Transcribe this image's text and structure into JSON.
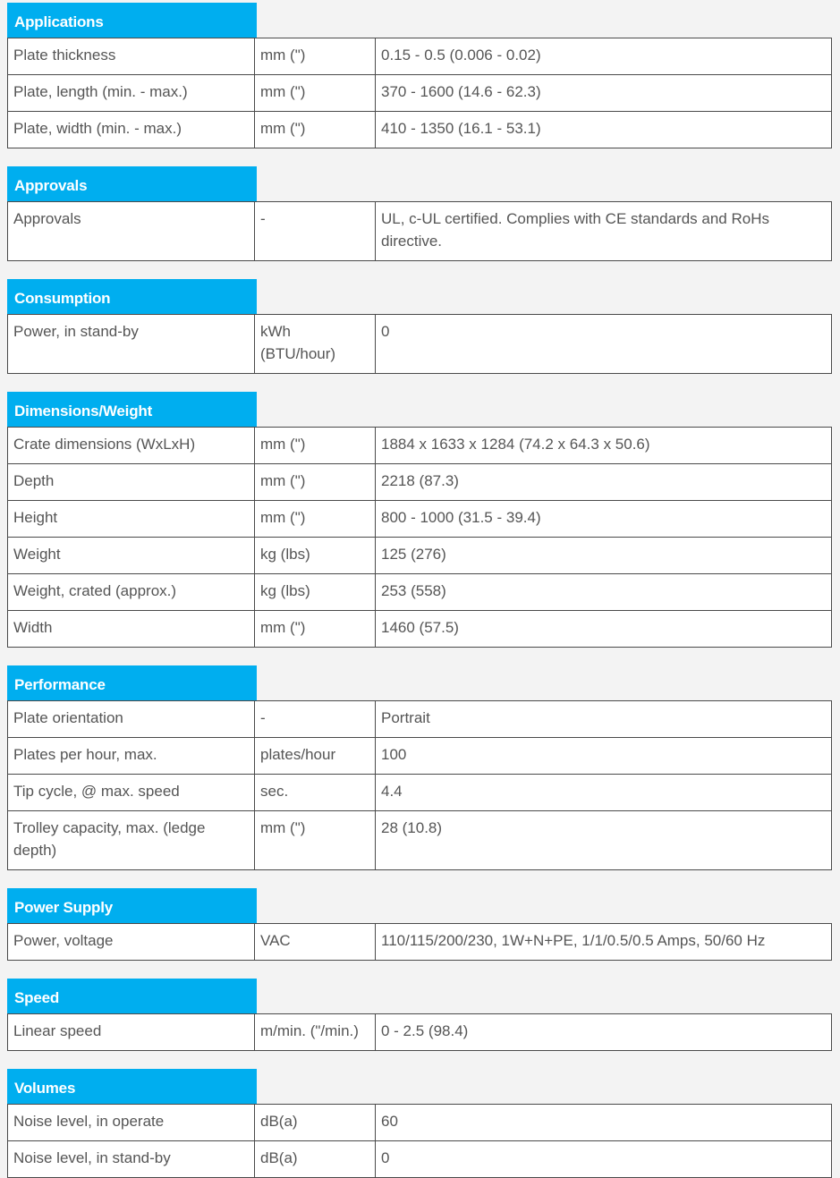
{
  "sections": [
    {
      "title": "Applications",
      "rows": [
        {
          "name": "Plate thickness",
          "unit": "mm (\")",
          "value": "0.15 - 0.5 (0.006 - 0.02)"
        },
        {
          "name": "Plate, length (min. - max.)",
          "unit": "mm (\")",
          "value": "370 - 1600 (14.6 - 62.3)"
        },
        {
          "name": "Plate, width (min. - max.)",
          "unit": "mm (\")",
          "value": "410 - 1350 (16.1 - 53.1)"
        }
      ]
    },
    {
      "title": "Approvals",
      "rows": [
        {
          "name": "Approvals",
          "unit": "-",
          "value": "UL, c-UL certified. Complies with CE standards and RoHs directive."
        }
      ]
    },
    {
      "title": "Consumption",
      "rows": [
        {
          "name": "Power, in stand-by",
          "unit": "kWh (BTU/hour)",
          "value": "0"
        }
      ]
    },
    {
      "title": "Dimensions/Weight",
      "rows": [
        {
          "name": "Crate dimensions (WxLxH)",
          "unit": "mm (\")",
          "value": "1884 x 1633 x 1284 (74.2 x 64.3 x 50.6)"
        },
        {
          "name": "Depth",
          "unit": "mm (\")",
          "value": "2218 (87.3)"
        },
        {
          "name": "Height",
          "unit": "mm (\")",
          "value": "800 - 1000 (31.5 - 39.4)"
        },
        {
          "name": "Weight",
          "unit": "kg (lbs)",
          "value": "125 (276)"
        },
        {
          "name": "Weight, crated (approx.)",
          "unit": "kg (lbs)",
          "value": "253 (558)"
        },
        {
          "name": "Width",
          "unit": "mm (\")",
          "value": "1460 (57.5)"
        }
      ]
    },
    {
      "title": "Performance",
      "rows": [
        {
          "name": "Plate orientation",
          "unit": "-",
          "value": "Portrait"
        },
        {
          "name": "Plates per hour, max.",
          "unit": "plates/hour",
          "value": "100"
        },
        {
          "name": "Tip cycle, @ max. speed",
          "unit": "sec.",
          "value": "4.4"
        },
        {
          "name": "Trolley capacity, max. (ledge depth)",
          "unit": "mm (\")",
          "value": "28 (10.8)"
        }
      ]
    },
    {
      "title": "Power Supply",
      "rows": [
        {
          "name": "Power, voltage",
          "unit": "VAC",
          "value": "110/115/200/230, 1W+N+PE, 1/1/0.5/0.5 Amps, 50/60 Hz"
        }
      ]
    },
    {
      "title": "Speed",
      "rows": [
        {
          "name": "Linear speed",
          "unit": "m/min. (\"/min.)",
          "value": "0 - 2.5 (98.4)"
        }
      ]
    },
    {
      "title": "Volumes",
      "rows": [
        {
          "name": "Noise level, in operate",
          "unit": "dB(a)",
          "value": "60"
        },
        {
          "name": "Noise level, in stand-by",
          "unit": "dB(a)",
          "value": "0"
        }
      ]
    }
  ],
  "colors": {
    "header_bg": "#00aeef",
    "header_text": "#ffffff",
    "page_bg": "#f3f3f3",
    "cell_text": "#555555",
    "border": "#4a4a4a"
  }
}
